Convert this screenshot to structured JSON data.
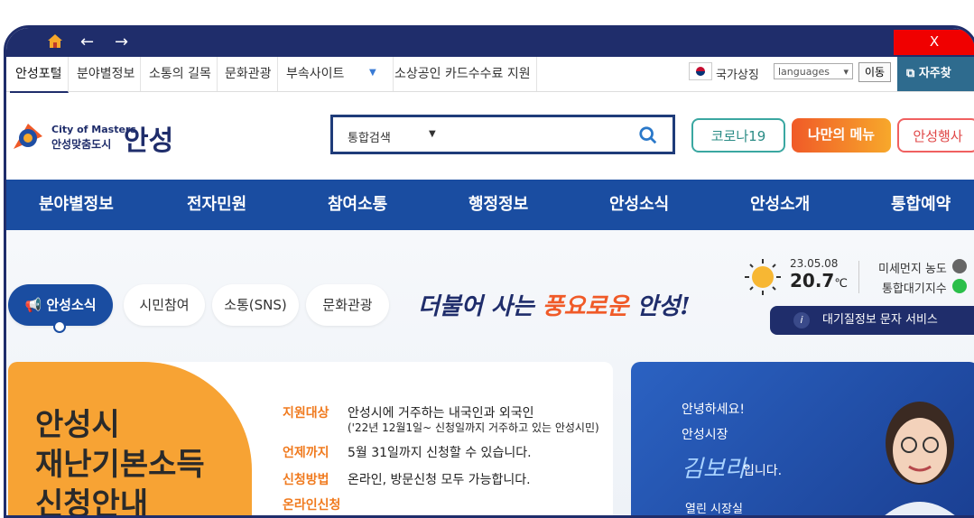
{
  "window": {
    "close_label": "X",
    "back_label": "←",
    "forward_label": "→"
  },
  "topnav": {
    "items": [
      "안성포털",
      "분야별정보",
      "소통의 길목",
      "문화관광",
      "부속사이트",
      "소상공인 카드수수료 지원"
    ],
    "national_symbol": "국가상징",
    "language_select": "languages",
    "go_button": "이동",
    "faq_button": "자주찾"
  },
  "header": {
    "logo_sub1": "City of Masters",
    "logo_sub2": "안성맞춤도시",
    "logo_main": "안성",
    "search_category": "통합검색",
    "corona_button": "코로나19",
    "mymenu_button": "나만의 메뉴",
    "event_button": "안성행사"
  },
  "mainnav": {
    "items": [
      "분야별정보",
      "전자민원",
      "참여소통",
      "행정정보",
      "안성소식",
      "안성소개",
      "통합예약"
    ]
  },
  "tabs": {
    "items": [
      "안성소식",
      "시민참여",
      "소통(SNS)",
      "문화관광"
    ]
  },
  "slogan": {
    "pre": "더불어 사는 ",
    "highlight": "풍요로운",
    "post": " 안성!"
  },
  "weather": {
    "date": "23.05.08",
    "temp": "20.7",
    "unit": "℃",
    "fine_dust": "미세먼지 농도",
    "air_index": "통합대기지수",
    "air_service": "대기질정보 문자 서비스"
  },
  "card": {
    "title_line1": "안성시",
    "title_line2": "재난기본소득",
    "title_line3": "신청안내",
    "rows": [
      {
        "key": "지원대상",
        "value": "안성시에 거주하는 내국인과 외국인",
        "sub": "('22년 12월1일~ 신청일까지 거주하고 있는 안성시민)"
      },
      {
        "key": "언제까지",
        "value": "5월 31일까지 신청할 수 있습니다."
      },
      {
        "key": "신청방법",
        "value": "온라인, 방문신청 모두 가능합니다."
      },
      {
        "key": "온라인신청",
        "value": ""
      }
    ]
  },
  "mayor": {
    "greeting": "안녕하세요!",
    "title": "안성시장",
    "name": "김보라",
    "suffix": "입니다.",
    "link": "열린 시장실"
  }
}
